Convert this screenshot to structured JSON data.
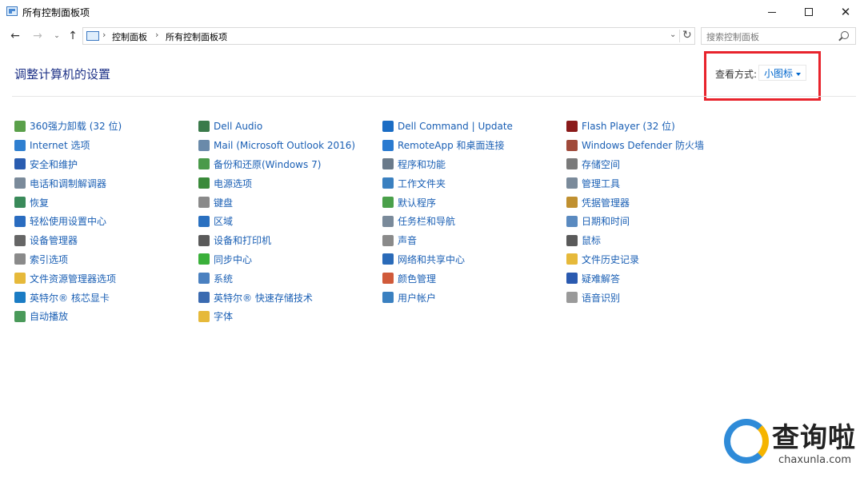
{
  "window": {
    "title": "所有控制面板项",
    "min_glyph": "",
    "close_glyph": "✕"
  },
  "nav": {
    "back_glyph": "←",
    "forward_glyph": "→",
    "recent_glyph": "⌄",
    "up_glyph": "↑"
  },
  "address": {
    "crumbs": [
      "控制面板",
      "所有控制面板项"
    ],
    "sep": "›",
    "dropdown_glyph": "⌄",
    "refresh_glyph": "↻"
  },
  "search": {
    "placeholder": "搜索控制面板"
  },
  "page": {
    "title": "调整计算机的设置",
    "view_by_label": "查看方式:",
    "view_by_value": "小图标"
  },
  "colors": {
    "link": "#1a5fb4",
    "title": "#1e3287",
    "highlight": "#e8232c"
  },
  "items": {
    "col1": [
      {
        "label": "360强力卸载 (32 位)",
        "icon": "uninstall-icon",
        "color": "#5aa04a"
      },
      {
        "label": "Internet 选项",
        "icon": "internet-options-icon",
        "color": "#2f7fd0"
      },
      {
        "label": "安全和维护",
        "icon": "flag-icon",
        "color": "#2a5db0"
      },
      {
        "label": "电话和调制解调器",
        "icon": "phone-modem-icon",
        "color": "#7a8a9a"
      },
      {
        "label": "恢复",
        "icon": "recovery-icon",
        "color": "#3a8a5a"
      },
      {
        "label": "轻松使用设置中心",
        "icon": "ease-of-access-icon",
        "color": "#2a6cc0"
      },
      {
        "label": "设备管理器",
        "icon": "device-manager-icon",
        "color": "#666666"
      },
      {
        "label": "索引选项",
        "icon": "indexing-icon",
        "color": "#8a8a8a"
      },
      {
        "label": "文件资源管理器选项",
        "icon": "folder-options-icon",
        "color": "#e6b93a"
      },
      {
        "label": "英特尔® 核芯显卡",
        "icon": "intel-graphics-icon",
        "color": "#1b7cc4"
      },
      {
        "label": "自动播放",
        "icon": "autoplay-icon",
        "color": "#4a9a5a"
      }
    ],
    "col2": [
      {
        "label": "Dell Audio",
        "icon": "dell-audio-icon",
        "color": "#3a7a4a"
      },
      {
        "label": "Mail (Microsoft Outlook 2016)",
        "icon": "mail-icon",
        "color": "#6a8aaa"
      },
      {
        "label": "备份和还原(Windows 7)",
        "icon": "backup-icon",
        "color": "#4a9a4a"
      },
      {
        "label": "电源选项",
        "icon": "power-icon",
        "color": "#3a8a3a"
      },
      {
        "label": "键盘",
        "icon": "keyboard-icon",
        "color": "#8a8a8a"
      },
      {
        "label": "区域",
        "icon": "region-icon",
        "color": "#2a70c0"
      },
      {
        "label": "设备和打印机",
        "icon": "printer-icon",
        "color": "#5a5a5a"
      },
      {
        "label": "同步中心",
        "icon": "sync-icon",
        "color": "#3ab03a"
      },
      {
        "label": "系统",
        "icon": "system-icon",
        "color": "#4a80c0"
      },
      {
        "label": "英特尔® 快速存储技术",
        "icon": "intel-rst-icon",
        "color": "#3a6ab0"
      },
      {
        "label": "字体",
        "icon": "fonts-icon",
        "color": "#e6b93a"
      }
    ],
    "col3": [
      {
        "label": "Dell Command | Update",
        "icon": "dell-update-icon",
        "color": "#1a6cc4"
      },
      {
        "label": "RemoteApp 和桌面连接",
        "icon": "remoteapp-icon",
        "color": "#2a7ad0"
      },
      {
        "label": "程序和功能",
        "icon": "programs-icon",
        "color": "#6a7a8a"
      },
      {
        "label": "工作文件夹",
        "icon": "work-folders-icon",
        "color": "#3a80c0"
      },
      {
        "label": "默认程序",
        "icon": "default-programs-icon",
        "color": "#4aa04a"
      },
      {
        "label": "任务栏和导航",
        "icon": "taskbar-icon",
        "color": "#7a8a9a"
      },
      {
        "label": "声音",
        "icon": "sound-icon",
        "color": "#8a8a8a"
      },
      {
        "label": "网络和共享中心",
        "icon": "network-icon",
        "color": "#2a6ab8"
      },
      {
        "label": "颜色管理",
        "icon": "color-management-icon",
        "color": "#d05a3a"
      },
      {
        "label": "用户帐户",
        "icon": "user-accounts-icon",
        "color": "#3a80c0"
      }
    ],
    "col4": [
      {
        "label": "Flash Player (32 位)",
        "icon": "flash-icon",
        "color": "#8a1a1a"
      },
      {
        "label": "Windows Defender 防火墙",
        "icon": "firewall-icon",
        "color": "#a04a3a"
      },
      {
        "label": "存储空间",
        "icon": "storage-spaces-icon",
        "color": "#7a7a7a"
      },
      {
        "label": "管理工具",
        "icon": "admin-tools-icon",
        "color": "#7a8a9a"
      },
      {
        "label": "凭据管理器",
        "icon": "credential-icon",
        "color": "#c09030"
      },
      {
        "label": "日期和时间",
        "icon": "date-time-icon",
        "color": "#5a8ac0"
      },
      {
        "label": "鼠标",
        "icon": "mouse-icon",
        "color": "#5a5a5a"
      },
      {
        "label": "文件历史记录",
        "icon": "file-history-icon",
        "color": "#e6b93a"
      },
      {
        "label": "疑难解答",
        "icon": "troubleshoot-icon",
        "color": "#2a5ab0"
      },
      {
        "label": "语音识别",
        "icon": "speech-icon",
        "color": "#9a9a9a"
      }
    ]
  },
  "watermark": {
    "text": "查询啦",
    "sub": "chaxunla.com"
  }
}
